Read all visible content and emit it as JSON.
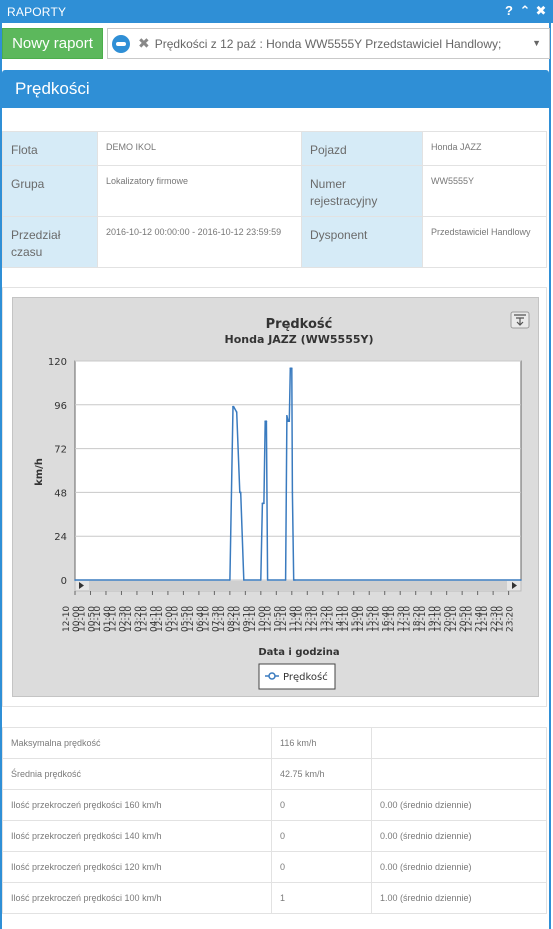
{
  "window": {
    "title": "RAPORTY"
  },
  "toolbar": {
    "new_report_label": "Nowy raport",
    "report_selector_value": "Prędkości z 12 paź : Honda WW5555Y Przedstawiciel Handlowy;"
  },
  "panel": {
    "title": "Prędkości"
  },
  "info": {
    "flota_label": "Flota",
    "flota_value": "DEMO IKOL",
    "pojazd_label": "Pojazd",
    "pojazd_value": "Honda JAZZ",
    "grupa_label": "Grupa",
    "grupa_value": "Lokalizatory firmowe",
    "numer_label": "Numer rejestracyjny",
    "numer_value": "WW5555Y",
    "przedzial_label": "Przedział czasu",
    "przedzial_value": "2016-10-12 00:00:00 - 2016-10-12 23:59:59",
    "dysponent_label": "Dysponent",
    "dysponent_value": "Przedstawiciel Handlowy"
  },
  "chart_data": {
    "type": "line",
    "title": "Prędkość",
    "subtitle": "Honda JAZZ (WW5555Y)",
    "xlabel": "Data i godzina",
    "ylabel": "km/h",
    "ylim": [
      0,
      120
    ],
    "yticks": [
      0,
      24,
      48,
      72,
      96,
      120
    ],
    "xticks": [
      "12-10 00:00",
      "12-10 01:40",
      "12-10 03:20",
      "12-10 05:00",
      "12-10 06:40",
      "12-10 08:20",
      "12-10 10:00",
      "12-10 11:40",
      "12-10 13:20",
      "12-10 15:00",
      "12-10 16:40",
      "12-10 18:20",
      "12-10 20:00",
      "12-10 21:40",
      "12-10 23:20"
    ],
    "xticks_minor": [
      "12-10 00:50",
      "12-10 02:30",
      "12-10 04:10",
      "12-10 05:50",
      "12-10 07:30",
      "12-10 09:10",
      "12-10 10:50",
      "12-10 12:30",
      "12-10 14:10",
      "12-10 15:50",
      "12-10 17:30",
      "12-10 19:10",
      "12-10 20:50",
      "12-10 22:30"
    ],
    "grid": true,
    "legend_position": "bottom-center",
    "series": [
      {
        "name": "Prędkość",
        "color": "#3a7bbf",
        "minutes": [
          0,
          500,
          510,
          512,
          522,
          532,
          535,
          545,
          600,
          605,
          610,
          614,
          618,
          622,
          680,
          684,
          688,
          692,
          695,
          700,
          702,
          706,
          710,
          1440
        ],
        "values": [
          0,
          0,
          95,
          95,
          92,
          48,
          48,
          0,
          0,
          42,
          42,
          87,
          87,
          0,
          0,
          90,
          87,
          87,
          116,
          116,
          48,
          0,
          0,
          0
        ]
      }
    ]
  },
  "stats": {
    "rows": [
      {
        "label": "Maksymalna prędkość",
        "value": "116 km/h",
        "extra": ""
      },
      {
        "label": "Średnia prędkość",
        "value": "42.75 km/h",
        "extra": ""
      },
      {
        "label": "Ilość przekroczeń prędkości 160 km/h",
        "value": "0",
        "extra": "0.00 (średnio dziennie)"
      },
      {
        "label": "Ilość przekroczeń prędkości 140 km/h",
        "value": "0",
        "extra": "0.00 (średnio dziennie)"
      },
      {
        "label": "Ilość przekroczeń prędkości 120 km/h",
        "value": "0",
        "extra": "0.00 (średnio dziennie)"
      },
      {
        "label": "Ilość przekroczeń prędkości 100 km/h",
        "value": "1",
        "extra": "1.00 (średnio dziennie)"
      }
    ]
  },
  "colors": {
    "accent": "#2f8fd6",
    "new_report_green": "#5cb85c",
    "label_cell_bg": "#d6ebf7"
  }
}
